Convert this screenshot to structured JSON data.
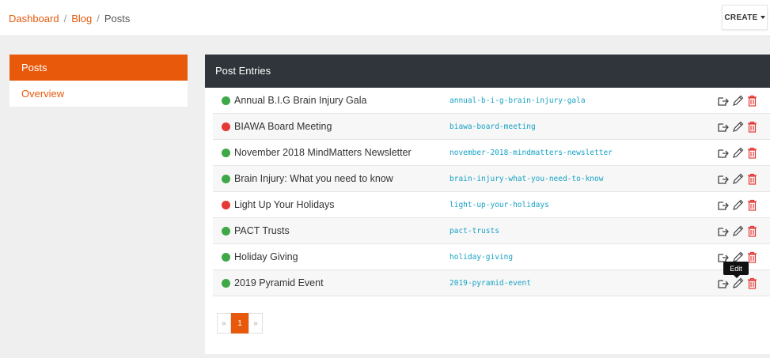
{
  "breadcrumb": {
    "items": [
      "Dashboard",
      "Blog",
      "Posts"
    ],
    "separator": "/"
  },
  "header": {
    "create_label": "CREATE"
  },
  "sidebar": {
    "items": [
      {
        "label": "Posts",
        "active": true
      },
      {
        "label": "Overview",
        "active": false
      }
    ]
  },
  "panel": {
    "title": "Post Entries"
  },
  "posts": [
    {
      "title": "Annual B.I.G Brain Injury Gala",
      "slug": "annual-b-i-g-brain-injury-gala",
      "status": "published"
    },
    {
      "title": "BIAWA Board Meeting",
      "slug": "biawa-board-meeting",
      "status": "unpublished"
    },
    {
      "title": "November 2018 MindMatters Newsletter",
      "slug": "november-2018-mindmatters-newsletter",
      "status": "published"
    },
    {
      "title": "Brain Injury: What you need to know",
      "slug": "brain-injury-what-you-need-to-know",
      "status": "published"
    },
    {
      "title": "Light Up Your Holidays",
      "slug": "light-up-your-holidays",
      "status": "unpublished"
    },
    {
      "title": "PACT Trusts",
      "slug": "pact-trusts",
      "status": "published"
    },
    {
      "title": "Holiday Giving",
      "slug": "holiday-giving",
      "status": "published"
    },
    {
      "title": "2019 Pyramid Event",
      "slug": "2019-pyramid-event",
      "status": "published"
    }
  ],
  "tooltip": {
    "text": "Edit"
  },
  "pagination": {
    "prev": "«",
    "current": "1",
    "next": "»"
  },
  "icons": {
    "actions": [
      "external-link-icon",
      "pencil-icon",
      "trash-icon"
    ],
    "status": "status-dot-icon"
  },
  "colors": {
    "accent": "#e8590c",
    "header_bg": "#2f353a",
    "published": "#3ea846",
    "unpublished": "#e53935",
    "slug": "#17a2c4",
    "trash": "#e53935"
  }
}
